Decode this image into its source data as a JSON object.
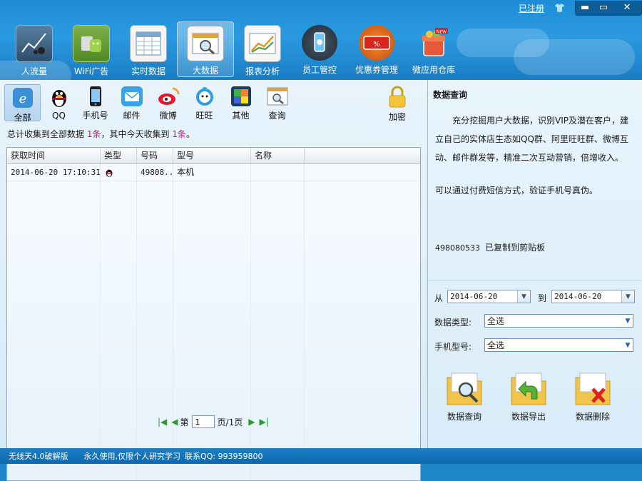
{
  "titlebar": {
    "register_link": "已注册"
  },
  "nav": [
    {
      "label": "人流量",
      "icon": "traffic-chart-icon"
    },
    {
      "label": "WiFi广告",
      "icon": "wifi-android-icon"
    },
    {
      "label": "实时数据",
      "icon": "spreadsheet-icon"
    },
    {
      "label": "大数据",
      "icon": "magnifier-window-icon",
      "active": true
    },
    {
      "label": "报表分析",
      "icon": "report-chart-icon"
    },
    {
      "label": "员工管控",
      "icon": "phone-control-icon"
    },
    {
      "label": "优惠券管理",
      "icon": "coupon-icon"
    },
    {
      "label": "微应用仓库",
      "icon": "app-store-gift-icon"
    }
  ],
  "subtabs": [
    {
      "label": "全部",
      "icon": "all-ie-icon",
      "active": true
    },
    {
      "label": "QQ",
      "icon": "qq-penguin-icon"
    },
    {
      "label": "手机号",
      "icon": "mobile-phone-icon"
    },
    {
      "label": "邮件",
      "icon": "mail-envelope-icon"
    },
    {
      "label": "微博",
      "icon": "weibo-icon"
    },
    {
      "label": "旺旺",
      "icon": "wangwang-icon"
    },
    {
      "label": "其他",
      "icon": "puzzle-icon"
    },
    {
      "label": "查询",
      "icon": "query-magnifier-icon"
    }
  ],
  "encrypt_label": "加密",
  "summary": {
    "prefix": "总计收集到全部数据 ",
    "total": "1条",
    "middle": "，其中今天收集到 ",
    "today": "1条",
    "suffix": "。"
  },
  "table": {
    "columns": [
      "获取时间",
      "类型",
      "号码",
      "型号",
      "名称"
    ],
    "rows": [
      {
        "time": "2014-06-20 17:10:31",
        "type_icon": "qq-penguin-icon",
        "number": "49808...",
        "model": "本机",
        "name": ""
      }
    ]
  },
  "pager": {
    "page_prefix": "第",
    "page_value": "1",
    "page_suffix": "页/1页"
  },
  "right": {
    "title": "数据查询",
    "description": "充分挖掘用户大数据，识别VIP及潜在客户，建立自己的实体店生态如QQ群、阿里旺旺群、微博互动、邮件群发等，精准二次互动营销，倍增收入。",
    "sms_note": "可以通过付费短信方式，验证手机号真伪。",
    "copied_number": "498080533",
    "copied_text": "已复制到剪贴板",
    "from_label": "从",
    "from_date": "2014-06-20",
    "to_label": "到",
    "to_date": "2014-06-20",
    "data_type_label": "数据类型:",
    "data_type_value": "全选",
    "phone_model_label": "手机型号:",
    "phone_model_value": "全选",
    "actions": [
      "数据查询",
      "数据导出",
      "数据删除"
    ]
  },
  "status": {
    "version": "无线天4.0破解版",
    "notice": "永久使用,仅限个人研究学习",
    "contact": "联系QQ: 993959800"
  },
  "colors": {
    "highlight": "#d0117a",
    "brand_blue": "#1f86c9"
  }
}
